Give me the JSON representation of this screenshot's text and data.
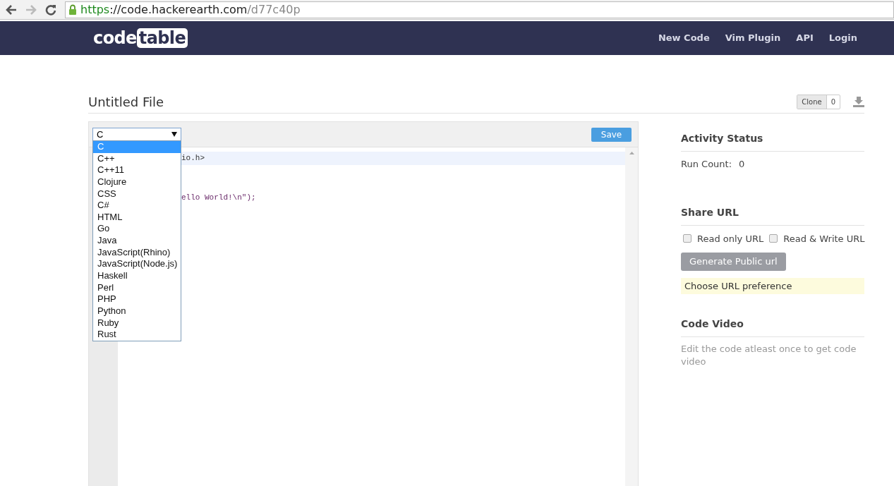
{
  "browser": {
    "back_enabled": true,
    "forward_enabled": false,
    "url": {
      "scheme": "https",
      "host": "://code.hackerearth.com",
      "path": "/d77c40p"
    }
  },
  "navbar": {
    "logo": {
      "plain": "code",
      "boxed": "table"
    },
    "links": [
      "New Code",
      "Vim Plugin",
      "API",
      "Login"
    ]
  },
  "file": {
    "title": "Untitled File",
    "clone_label": "Clone",
    "clone_count": "0"
  },
  "editor": {
    "language": "C",
    "save_label": "Save",
    "code_lines": [
      {
        "text": "io.h>",
        "active": true
      },
      {
        "text": "ello World!\\n\");",
        "active": false
      }
    ],
    "dropdown": [
      {
        "label": "C",
        "selected": true
      },
      {
        "label": "C++",
        "selected": false
      },
      {
        "label": "C++11",
        "selected": false
      },
      {
        "label": "Clojure",
        "selected": false
      },
      {
        "label": "CSS",
        "selected": false
      },
      {
        "label": "C#",
        "selected": false
      },
      {
        "label": "HTML",
        "selected": false
      },
      {
        "label": "Go",
        "selected": false
      },
      {
        "label": "Java",
        "selected": false
      },
      {
        "label": "JavaScript(Rhino)",
        "selected": false
      },
      {
        "label": "JavaScript(Node.js)",
        "selected": false
      },
      {
        "label": "Haskell",
        "selected": false
      },
      {
        "label": "Perl",
        "selected": false
      },
      {
        "label": "PHP",
        "selected": false
      },
      {
        "label": "Python",
        "selected": false
      },
      {
        "label": "Ruby",
        "selected": false
      },
      {
        "label": "Rust",
        "selected": false
      }
    ]
  },
  "activity_status": {
    "heading": "Activity Status",
    "run_count_label": "Run Count:",
    "run_count": "0"
  },
  "share_url": {
    "heading": "Share URL",
    "options": [
      {
        "label": "Read only URL",
        "checked": false
      },
      {
        "label": "Read & Write URL",
        "checked": false
      }
    ],
    "generate_label": "Generate Public url",
    "notice": "Choose URL preference"
  },
  "code_video": {
    "heading": "Code Video",
    "message": "Edit the code atleast once to get code video"
  }
}
